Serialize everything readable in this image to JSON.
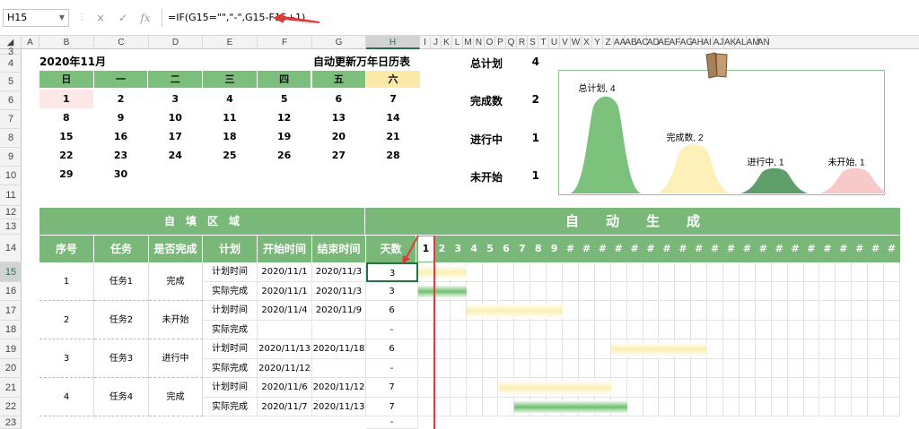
{
  "formula_bar": {
    "name_box": "H15",
    "cancel_icon": "×",
    "enter_icon": "✓",
    "fx_label": "fx",
    "formula": "=IF(G15=\"\",\"-\",G15-F15+1)"
  },
  "columns": [
    "A",
    "B",
    "C",
    "D",
    "E",
    "F",
    "G",
    "H",
    "I",
    "J",
    "K",
    "L",
    "M",
    "N",
    "O",
    "P",
    "Q",
    "R",
    "S",
    "T",
    "U",
    "V",
    "W",
    "X",
    "Y",
    "Z",
    "AA",
    "AB",
    "AC",
    "AD",
    "AE",
    "AF",
    "AG",
    "AH",
    "AI",
    "AJ",
    "AK",
    "AL",
    "AM",
    "AN"
  ],
  "selected_column": "H",
  "rows": [
    "3",
    "4",
    "5",
    "6",
    "7",
    "8",
    "9",
    "10",
    "11",
    "12",
    "13",
    "14",
    "15",
    "16",
    "17",
    "18",
    "19",
    "20",
    "21",
    "22",
    "23"
  ],
  "selected_row": "15",
  "calendar": {
    "month_title": "2020年11月",
    "subtitle": "自动更新万年日历表",
    "weekdays": [
      "日",
      "一",
      "二",
      "三",
      "四",
      "五",
      "六"
    ],
    "weeks": [
      [
        "1",
        "2",
        "3",
        "4",
        "5",
        "6",
        "7"
      ],
      [
        "8",
        "9",
        "10",
        "11",
        "12",
        "13",
        "14"
      ],
      [
        "15",
        "16",
        "17",
        "18",
        "19",
        "20",
        "21"
      ],
      [
        "22",
        "23",
        "24",
        "25",
        "26",
        "27",
        "28"
      ],
      [
        "29",
        "30",
        "",
        "",
        "",
        "",
        ""
      ]
    ]
  },
  "stats": [
    {
      "label": "总计划",
      "value": "4"
    },
    {
      "label": "完成数",
      "value": "2"
    },
    {
      "label": "进行中",
      "value": "1"
    },
    {
      "label": "未开始",
      "value": "1"
    }
  ],
  "chart_data": {
    "type": "area",
    "categories": [
      "总计划",
      "完成数",
      "进行中",
      "未开始"
    ],
    "values": [
      4,
      2,
      1,
      1
    ],
    "data_labels": [
      "总计划, 4",
      "完成数, 2",
      "进行中, 1",
      "未开始, 1"
    ],
    "colors": [
      "#7cc27c",
      "#fdf0b8",
      "#5f9e6a",
      "#f7c9c9"
    ]
  },
  "section_fill": "自　填　区　域",
  "section_auto": "自　　动　　生　　成",
  "table_headers": [
    "序号",
    "任务",
    "是否完成",
    "计划",
    "开始时间",
    "结束时间",
    "天数"
  ],
  "day_numbers": [
    "1",
    "2",
    "3",
    "4",
    "5",
    "6",
    "7",
    "8",
    "9",
    "#",
    "#",
    "#",
    "#",
    "#",
    "#",
    "#",
    "#",
    "#",
    "#",
    "#",
    "#",
    "#",
    "#",
    "#",
    "#",
    "#",
    "#",
    "#",
    "#",
    "#"
  ],
  "tasks": [
    {
      "id": "1",
      "name": "任务1",
      "status": "完成",
      "plan": {
        "label": "计划时间",
        "start": "2020/11/1",
        "end": "2020/11/3",
        "days": "3"
      },
      "actual": {
        "label": "实际完成",
        "start": "2020/11/1",
        "end": "2020/11/3",
        "days": "3"
      }
    },
    {
      "id": "2",
      "name": "任务2",
      "status": "未开始",
      "plan": {
        "label": "计划时间",
        "start": "2020/11/4",
        "end": "2020/11/9",
        "days": "6"
      },
      "actual": {
        "label": "实际完成",
        "start": "",
        "end": "",
        "days": "-"
      }
    },
    {
      "id": "3",
      "name": "任务3",
      "status": "进行中",
      "plan": {
        "label": "计划时间",
        "start": "2020/11/13",
        "end": "2020/11/18",
        "days": "6"
      },
      "actual": {
        "label": "实际完成",
        "start": "2020/11/12",
        "end": "",
        "days": "-"
      }
    },
    {
      "id": "4",
      "name": "任务4",
      "status": "完成",
      "plan": {
        "label": "计划时间",
        "start": "2020/11/6",
        "end": "2020/11/12",
        "days": "7"
      },
      "actual": {
        "label": "实际完成",
        "start": "2020/11/7",
        "end": "2020/11/13",
        "days": "7"
      }
    }
  ],
  "row23_days": "-",
  "colors": {
    "header_green": "#7ab87a",
    "plan_bar": "#fbeeb3",
    "actual_bar": "#6fbf6f",
    "today_line": "#e23a3a",
    "excel_green": "#217346"
  }
}
